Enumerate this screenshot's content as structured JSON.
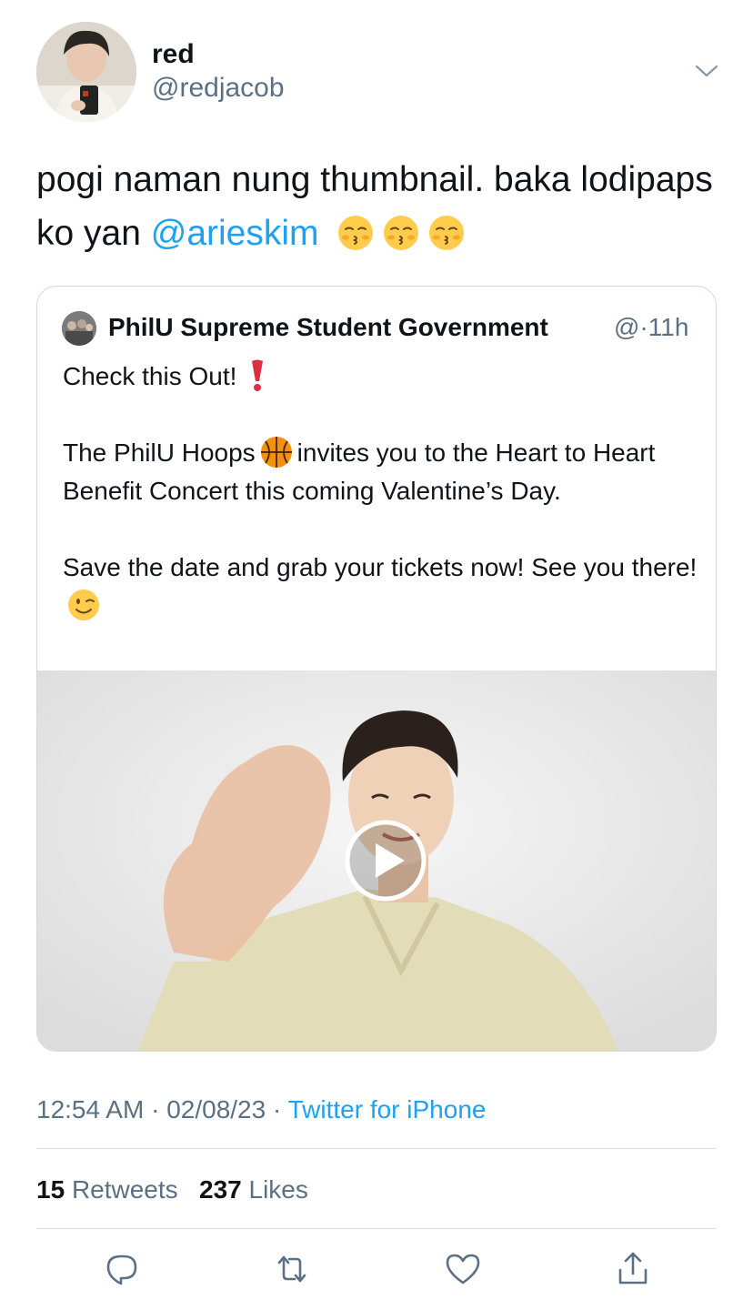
{
  "author": {
    "display_name": "red",
    "handle": "@redjacob"
  },
  "tweet": {
    "text_before_mention": "pogi naman nung thumbnail. baka lodipaps ko yan ",
    "mention": "@arieskim",
    "trailing_emojis": [
      "kissing-closed-eyes",
      "kissing-closed-eyes",
      "kissing-closed-eyes"
    ]
  },
  "quoted_tweet": {
    "author_name": "PhilU Supreme Student Government",
    "handle_truncated": "@",
    "separator": "·",
    "time_ago": "11h",
    "line_1": "Check this Out!",
    "line_2_part1": "The PhilU Hoops",
    "line_2_part2": "invites you to the Heart to Heart Benefit Concert this coming Valentine’s Day.",
    "line_3": "Save the date and grab your tickets now! See you there!",
    "emojis": {
      "line_1": "heavy-exclamation-mark",
      "line_2": "basketball",
      "line_3": "winking-face"
    }
  },
  "meta": {
    "time": "12:54 AM",
    "separator": "·",
    "date": "02/08/23",
    "source": "Twitter for iPhone"
  },
  "stats": {
    "retweets_count": "15",
    "retweets_label": "Retweets",
    "likes_count": "237",
    "likes_label": "Likes"
  },
  "actions": [
    "reply-icon",
    "retweet-icon",
    "like-icon",
    "share-icon"
  ],
  "colors": {
    "link": "#1da1f2",
    "secondary_text": "#5b7083",
    "primary_text": "#0f1419",
    "border": "#cfd9de"
  }
}
